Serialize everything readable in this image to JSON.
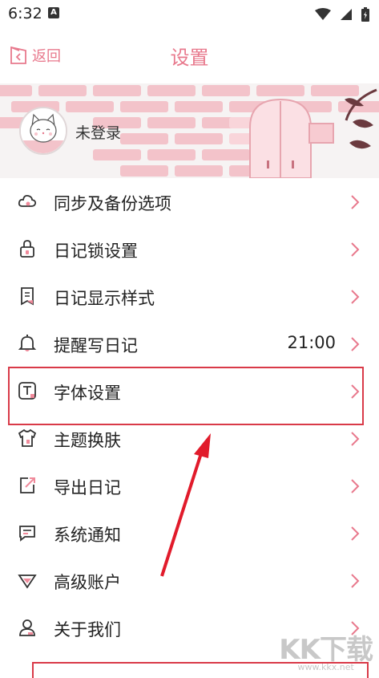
{
  "status_bar": {
    "time": "6:32",
    "notification_badge": "A"
  },
  "top_bar": {
    "back_label": "返回",
    "title": "设置"
  },
  "profile": {
    "login_label": "未登录"
  },
  "menu_items": [
    {
      "icon": "cloud-icon",
      "label": "同步及备份选项"
    },
    {
      "icon": "lock-icon",
      "label": "日记锁设置"
    },
    {
      "icon": "bookmark-icon",
      "label": "日记显示样式"
    },
    {
      "icon": "bell-icon",
      "label": "提醒写日记",
      "value": "21:00"
    },
    {
      "icon": "font-icon",
      "label": "字体设置"
    },
    {
      "icon": "shirt-icon",
      "label": "主题换肤"
    },
    {
      "icon": "export-icon",
      "label": "导出日记"
    },
    {
      "icon": "message-icon",
      "label": "系统通知"
    },
    {
      "icon": "diamond-icon",
      "label": "高级账户"
    },
    {
      "icon": "user-icon",
      "label": "关于我们"
    }
  ],
  "watermark": {
    "text": "KK下载",
    "url": "www.kkx.net"
  },
  "colors": {
    "accent": "#e8798d",
    "highlight": "#d93a48"
  }
}
